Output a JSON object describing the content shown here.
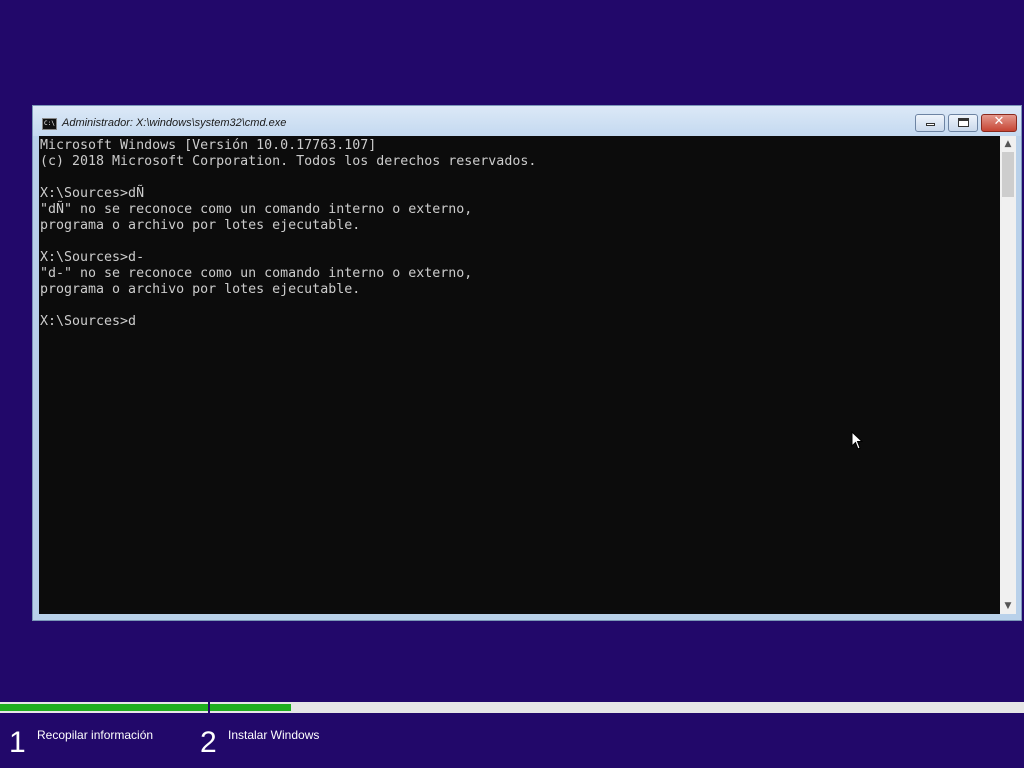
{
  "window": {
    "title": "Administrador: X:\\windows\\system32\\cmd.exe",
    "icon": "cmd-icon",
    "controls": {
      "minimize": "minimize-icon",
      "maximize": "maximize-icon",
      "close": "✕"
    }
  },
  "console": {
    "lines": [
      "Microsoft Windows [Versión 10.0.17763.107]",
      "(c) 2018 Microsoft Corporation. Todos los derechos reservados.",
      "",
      "X:\\Sources>dÑ",
      "\"dÑ\" no se reconoce como un comando interno o externo,",
      "programa o archivo por lotes ejecutable.",
      "",
      "X:\\Sources>d-",
      "\"d-\" no se reconoce como un comando interno o externo,",
      "programa o archivo por lotes ejecutable.",
      "",
      "X:\\Sources>d"
    ],
    "foreground": "#cccccc",
    "background": "#0c0c0c"
  },
  "scrollbar": {
    "up": "▲",
    "down": "▼"
  },
  "setup": {
    "accent": "#1fae1f",
    "background": "#22086a",
    "steps": [
      {
        "number": "1",
        "label": "Recopilar información",
        "progress": 1.0
      },
      {
        "number": "2",
        "label": "Instalar Windows",
        "progress": 0.1
      }
    ]
  }
}
